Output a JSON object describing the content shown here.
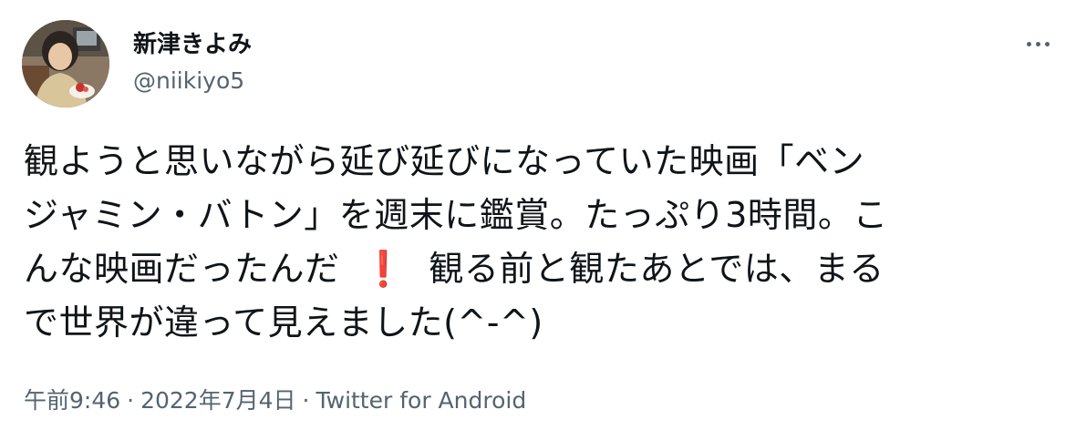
{
  "author": {
    "display_name": "新津きよみ",
    "handle": "@niikiyo5",
    "avatar_icon": "profile-photo"
  },
  "menu": {
    "icon": "more-horizontal-icon"
  },
  "tweet": {
    "lines": [
      "観ようと思いながら延び延びになっていた映画「ベン",
      "ジャミン・バトン」を週末に鑑賞。たっぷり3時間。こ",
      "んな映画だったんだ",
      "観る前と観たあとでは、まる",
      "で世界が違って見えました(^-^)"
    ],
    "emoji": "❗",
    "emoji_color": "#e0242f"
  },
  "meta": {
    "time": "午前9:46",
    "date": "2022年7月4日",
    "separator": "·",
    "source": "Twitter for Android"
  },
  "colors": {
    "text": "#0f1419",
    "secondary": "#536471"
  }
}
